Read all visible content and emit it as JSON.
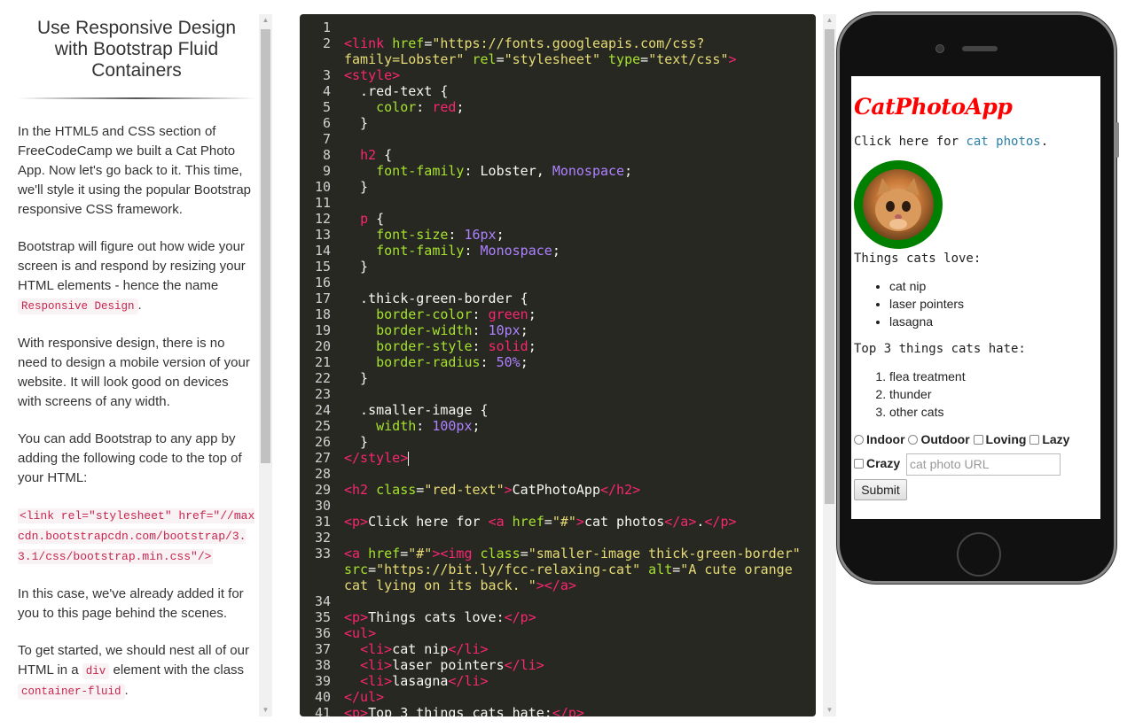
{
  "lesson": {
    "title": "Use Responsive Design with Bootstrap Fluid Containers",
    "p1": "In the HTML5 and CSS section of FreeCodeCamp we built a Cat Photo App. Now let's go back to it. This time, we'll style it using the popular Bootstrap responsive CSS framework.",
    "p2_before": "Bootstrap will figure out how wide your screen is and respond by resizing your HTML elements - hence the name ",
    "p2_code": "Responsive Design",
    "p2_after": ".",
    "p3": "With responsive design, there is no need to design a mobile version of your website. It will look good on devices with screens of any width.",
    "p4": "You can add Bootstrap to any app by adding the following code to the top of your HTML:",
    "snippet": "<link rel=\"stylesheet\" href=\"//maxcdn.bootstrapcdn.com/bootstrap/3.3.1/css/bootstrap.min.css\"/>",
    "p5": "In this case, we've already added it for you to this page behind the scenes.",
    "p6_before": "To get started, we should nest all of our HTML in a ",
    "p6_code": "div",
    "p6_after": " element with the class ",
    "p6_code2": "container-fluid",
    "p6_end": "."
  },
  "editor": {
    "colors": {
      "tag": "#f92672",
      "attr": "#a6e22e",
      "string": "#e6db74",
      "text": "#f8f8f2",
      "number": "#ae81ff",
      "prop": "#a6e22e"
    },
    "lines": [
      {
        "n": "1",
        "segs": []
      },
      {
        "n": "2",
        "segs": [
          [
            "tag",
            "<link "
          ],
          [
            "attr",
            "href"
          ],
          [
            "text",
            "="
          ],
          [
            "string",
            "\"https://fonts.googleapis.com/css?"
          ]
        ]
      },
      {
        "n": "",
        "segs": [
          [
            "string",
            "family=Lobster\" "
          ],
          [
            "attr",
            "rel"
          ],
          [
            "text",
            "="
          ],
          [
            "string",
            "\"stylesheet\" "
          ],
          [
            "attr",
            "type"
          ],
          [
            "text",
            "="
          ],
          [
            "string",
            "\"text/css\""
          ],
          [
            "tag",
            ">"
          ]
        ]
      },
      {
        "n": "3",
        "segs": [
          [
            "tag",
            "<style>"
          ]
        ]
      },
      {
        "n": "4",
        "segs": [
          [
            "text",
            "  .red-text {"
          ]
        ]
      },
      {
        "n": "5",
        "segs": [
          [
            "text",
            "    "
          ],
          [
            "prop",
            "color"
          ],
          [
            "text",
            ": "
          ],
          [
            "tag",
            "red"
          ],
          [
            "text",
            ";"
          ]
        ]
      },
      {
        "n": "6",
        "segs": [
          [
            "text",
            "  }"
          ]
        ]
      },
      {
        "n": "7",
        "segs": []
      },
      {
        "n": "8",
        "segs": [
          [
            "text",
            "  "
          ],
          [
            "tag",
            "h2"
          ],
          [
            "text",
            " {"
          ]
        ]
      },
      {
        "n": "9",
        "segs": [
          [
            "text",
            "    "
          ],
          [
            "prop",
            "font-family"
          ],
          [
            "text",
            ": Lobster, "
          ],
          [
            "number",
            "Monospace"
          ],
          [
            "text",
            ";"
          ]
        ]
      },
      {
        "n": "10",
        "segs": [
          [
            "text",
            "  }"
          ]
        ]
      },
      {
        "n": "11",
        "segs": []
      },
      {
        "n": "12",
        "segs": [
          [
            "text",
            "  "
          ],
          [
            "tag",
            "p"
          ],
          [
            "text",
            " {"
          ]
        ]
      },
      {
        "n": "13",
        "segs": [
          [
            "text",
            "    "
          ],
          [
            "prop",
            "font-size"
          ],
          [
            "text",
            ": "
          ],
          [
            "number",
            "16px"
          ],
          [
            "text",
            ";"
          ]
        ]
      },
      {
        "n": "14",
        "segs": [
          [
            "text",
            "    "
          ],
          [
            "prop",
            "font-family"
          ],
          [
            "text",
            ": "
          ],
          [
            "number",
            "Monospace"
          ],
          [
            "text",
            ";"
          ]
        ]
      },
      {
        "n": "15",
        "segs": [
          [
            "text",
            "  }"
          ]
        ]
      },
      {
        "n": "16",
        "segs": []
      },
      {
        "n": "17",
        "segs": [
          [
            "text",
            "  .thick-green-border {"
          ]
        ]
      },
      {
        "n": "18",
        "segs": [
          [
            "text",
            "    "
          ],
          [
            "prop",
            "border-color"
          ],
          [
            "text",
            ": "
          ],
          [
            "tag",
            "green"
          ],
          [
            "text",
            ";"
          ]
        ]
      },
      {
        "n": "19",
        "segs": [
          [
            "text",
            "    "
          ],
          [
            "prop",
            "border-width"
          ],
          [
            "text",
            ": "
          ],
          [
            "number",
            "10px"
          ],
          [
            "text",
            ";"
          ]
        ]
      },
      {
        "n": "20",
        "segs": [
          [
            "text",
            "    "
          ],
          [
            "prop",
            "border-style"
          ],
          [
            "text",
            ": "
          ],
          [
            "tag",
            "solid"
          ],
          [
            "text",
            ";"
          ]
        ]
      },
      {
        "n": "21",
        "segs": [
          [
            "text",
            "    "
          ],
          [
            "prop",
            "border-radius"
          ],
          [
            "text",
            ": "
          ],
          [
            "number",
            "50%"
          ],
          [
            "text",
            ";"
          ]
        ]
      },
      {
        "n": "22",
        "segs": [
          [
            "text",
            "  }"
          ]
        ]
      },
      {
        "n": "23",
        "segs": []
      },
      {
        "n": "24",
        "segs": [
          [
            "text",
            "  .smaller-image {"
          ]
        ]
      },
      {
        "n": "25",
        "segs": [
          [
            "text",
            "    "
          ],
          [
            "prop",
            "width"
          ],
          [
            "text",
            ": "
          ],
          [
            "number",
            "100px"
          ],
          [
            "text",
            ";"
          ]
        ]
      },
      {
        "n": "26",
        "segs": [
          [
            "text",
            "  }"
          ]
        ]
      },
      {
        "n": "27",
        "segs": [
          [
            "tag",
            "</style>"
          ]
        ],
        "cursor": true
      },
      {
        "n": "28",
        "segs": []
      },
      {
        "n": "29",
        "segs": [
          [
            "tag",
            "<h2 "
          ],
          [
            "attr",
            "class"
          ],
          [
            "text",
            "="
          ],
          [
            "string",
            "\"red-text\""
          ],
          [
            "tag",
            ">"
          ],
          [
            "text",
            "CatPhotoApp"
          ],
          [
            "tag",
            "</h2>"
          ]
        ]
      },
      {
        "n": "30",
        "segs": []
      },
      {
        "n": "31",
        "segs": [
          [
            "tag",
            "<p>"
          ],
          [
            "text",
            "Click here for "
          ],
          [
            "tag",
            "<a "
          ],
          [
            "attr",
            "href"
          ],
          [
            "text",
            "="
          ],
          [
            "string",
            "\"#\""
          ],
          [
            "tag",
            ">"
          ],
          [
            "text",
            "cat photos"
          ],
          [
            "tag",
            "</a>"
          ],
          [
            "text",
            "."
          ],
          [
            "tag",
            "</p>"
          ]
        ]
      },
      {
        "n": "32",
        "segs": []
      },
      {
        "n": "33",
        "segs": [
          [
            "tag",
            "<a "
          ],
          [
            "attr",
            "href"
          ],
          [
            "text",
            "="
          ],
          [
            "string",
            "\"#\""
          ],
          [
            "tag",
            "><img "
          ],
          [
            "attr",
            "class"
          ],
          [
            "text",
            "="
          ],
          [
            "string",
            "\"smaller-image thick-green-border\""
          ]
        ]
      },
      {
        "n": "",
        "segs": [
          [
            "attr",
            "src"
          ],
          [
            "text",
            "="
          ],
          [
            "string",
            "\"https://bit.ly/fcc-relaxing-cat\" "
          ],
          [
            "attr",
            "alt"
          ],
          [
            "text",
            "="
          ],
          [
            "string",
            "\"A cute orange"
          ]
        ]
      },
      {
        "n": "",
        "segs": [
          [
            "string",
            "cat lying on its back. \""
          ],
          [
            "tag",
            "></a>"
          ]
        ]
      },
      {
        "n": "34",
        "segs": []
      },
      {
        "n": "35",
        "segs": [
          [
            "tag",
            "<p>"
          ],
          [
            "text",
            "Things cats love:"
          ],
          [
            "tag",
            "</p>"
          ]
        ]
      },
      {
        "n": "36",
        "segs": [
          [
            "tag",
            "<ul>"
          ]
        ]
      },
      {
        "n": "37",
        "segs": [
          [
            "text",
            "  "
          ],
          [
            "tag",
            "<li>"
          ],
          [
            "text",
            "cat nip"
          ],
          [
            "tag",
            "</li>"
          ]
        ]
      },
      {
        "n": "38",
        "segs": [
          [
            "text",
            "  "
          ],
          [
            "tag",
            "<li>"
          ],
          [
            "text",
            "laser pointers"
          ],
          [
            "tag",
            "</li>"
          ]
        ]
      },
      {
        "n": "39",
        "segs": [
          [
            "text",
            "  "
          ],
          [
            "tag",
            "<li>"
          ],
          [
            "text",
            "lasagna"
          ],
          [
            "tag",
            "</li>"
          ]
        ]
      },
      {
        "n": "40",
        "segs": [
          [
            "tag",
            "</ul>"
          ]
        ]
      },
      {
        "n": "41",
        "segs": [
          [
            "tag",
            "<p>"
          ],
          [
            "text",
            "Top 3 things cats hate:"
          ],
          [
            "tag",
            "</p>"
          ]
        ]
      }
    ]
  },
  "preview": {
    "title": "CatPhotoApp",
    "click_text": "Click here for ",
    "link_text": "cat photos",
    "link_end": ".",
    "love_heading": "Things cats love:",
    "love_items": [
      "cat nip",
      "laser pointers",
      "lasagna"
    ],
    "hate_heading": "Top 3 things cats hate:",
    "hate_items": [
      "flea treatment",
      "thunder",
      "other cats"
    ],
    "radio_indoor": "Indoor",
    "radio_outdoor": "Outdoor",
    "check_loving": "Loving",
    "check_lazy": "Lazy",
    "check_crazy": "Crazy",
    "url_placeholder": "cat photo URL",
    "submit_label": "Submit"
  }
}
